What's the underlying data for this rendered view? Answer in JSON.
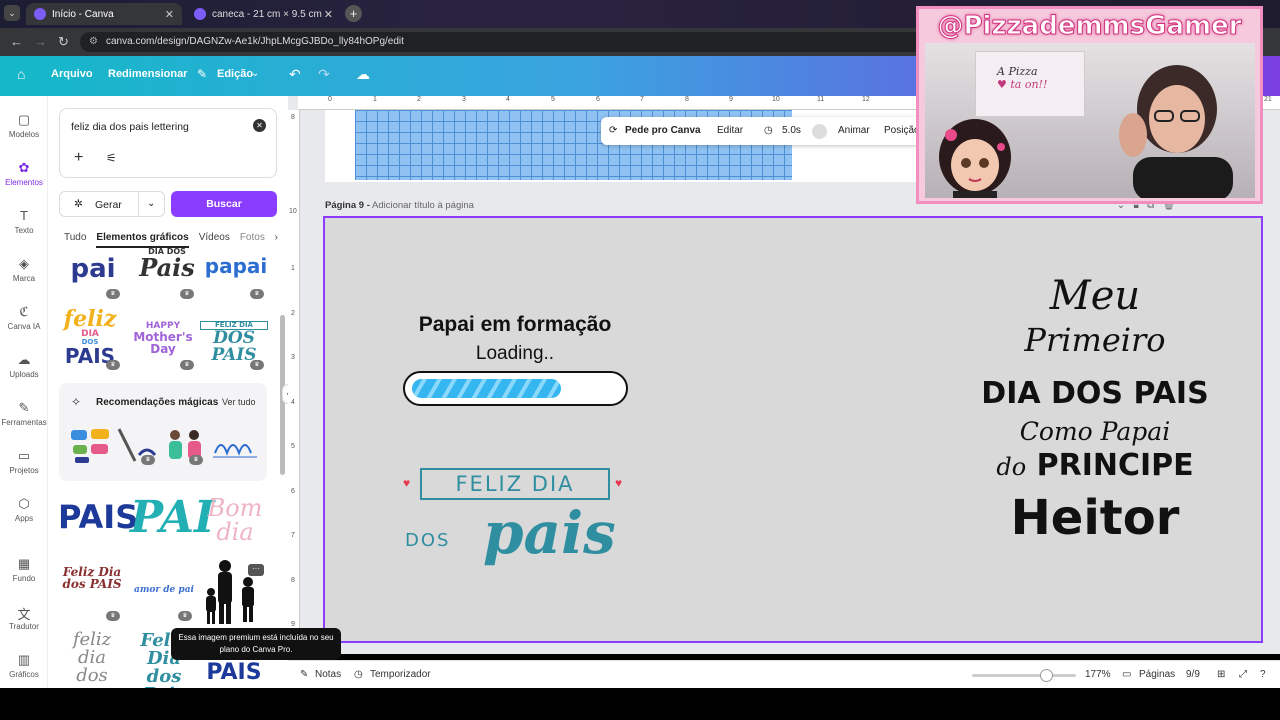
{
  "browser": {
    "tabs": [
      {
        "title": "Início - Canva",
        "active": true
      },
      {
        "title": "caneca - 21 cm × 9.5 cm",
        "active": false
      }
    ],
    "url": "canva.com/design/DAGNZw-Ae1k/JhpLMcgGJBDo_lly84hOPg/edit"
  },
  "header": {
    "arquivo": "Arquivo",
    "redimensionar": "Redimensionar",
    "edicao": "Edição"
  },
  "rail": [
    {
      "label": "Modelos",
      "icon": "templates-icon"
    },
    {
      "label": "Elementos",
      "icon": "elements-icon"
    },
    {
      "label": "Texto",
      "icon": "text-icon"
    },
    {
      "label": "Marca",
      "icon": "brand-icon"
    },
    {
      "label": "Canva IA",
      "icon": "ai-icon"
    },
    {
      "label": "Uploads",
      "icon": "upload-icon"
    },
    {
      "label": "Ferramentas",
      "icon": "tools-icon"
    },
    {
      "label": "Projetos",
      "icon": "folder-icon"
    },
    {
      "label": "Apps",
      "icon": "apps-icon"
    },
    {
      "label": "Fundo",
      "icon": "background-icon"
    },
    {
      "label": "Tradutor",
      "icon": "translate-icon"
    },
    {
      "label": "Gráficos",
      "icon": "charts-icon"
    }
  ],
  "panel": {
    "search_value": "feliz dia dos pais lettering",
    "generate": "Gerar",
    "search_button": "Buscar",
    "tabs": [
      "Tudo",
      "Elementos gráficos",
      "Vídeos",
      "Fotos"
    ],
    "magic_title": "Recomendações mágicas",
    "magic_link": "Ver tudo",
    "graphics": {
      "pai1": "pai",
      "dia_dos_pais": "DIA DOS",
      "pais_script": "Pais",
      "papai": "papai",
      "feliz": "feliz",
      "dia": "DIA",
      "dos": "DOS",
      "pais2": "PAIS",
      "happy": "HAPPY",
      "mothers": "Mother's",
      "day": "Day",
      "feliz_dia": "FELIZ DIA",
      "dos_pais_small": "DOS PAIS",
      "big_pais": "PAIS",
      "big_pai": "PAI",
      "bom_dia": "Bom dia",
      "feliz_dia_pais": "Feliz Dia dos PAIS",
      "amor_de_pai": "amor de pai",
      "feliz_dia_dos_pais": "feliz dia dos",
      "feliz_teal": "Feliz Dia dos Pais",
      "pais_bottom": "PAIS"
    },
    "tooltip": "Essa imagem premium está incluída no seu plano do Canva Pro."
  },
  "context_bar": {
    "pede": "Pede pro Canva",
    "editar": "Editar",
    "duration": "5.0s",
    "animar": "Animar",
    "posicao": "Posição"
  },
  "page": {
    "label": "Página 9 -",
    "subtitle": "Adicionar título à página"
  },
  "design": {
    "formacao": "Papai em formação",
    "loading": "Loading..",
    "progress": 0.72,
    "feliz_dia": "FELIZ DIA",
    "dos": "DOS",
    "pais": "pais",
    "meu": "Meu",
    "primeiro": "Primeiro",
    "dia_dos_pais": "DIA DOS PAIS",
    "como_papai": "Como Papai",
    "do": "do",
    "principe": "PRINCIPE",
    "heitor": "Heitor"
  },
  "webcam": {
    "title": "@PizzademmsGamer",
    "sign_line1": "A  Pizza",
    "sign_line2": "♥ ta on!!"
  },
  "bottombar": {
    "notas": "Notas",
    "temporizador": "Temporizador",
    "zoom": "177%",
    "paginas": "Páginas",
    "page_count": "9/9"
  },
  "colors": {
    "accent": "#8b3dff",
    "teal": "#2f8fa0",
    "progress": "#35b6f0"
  }
}
